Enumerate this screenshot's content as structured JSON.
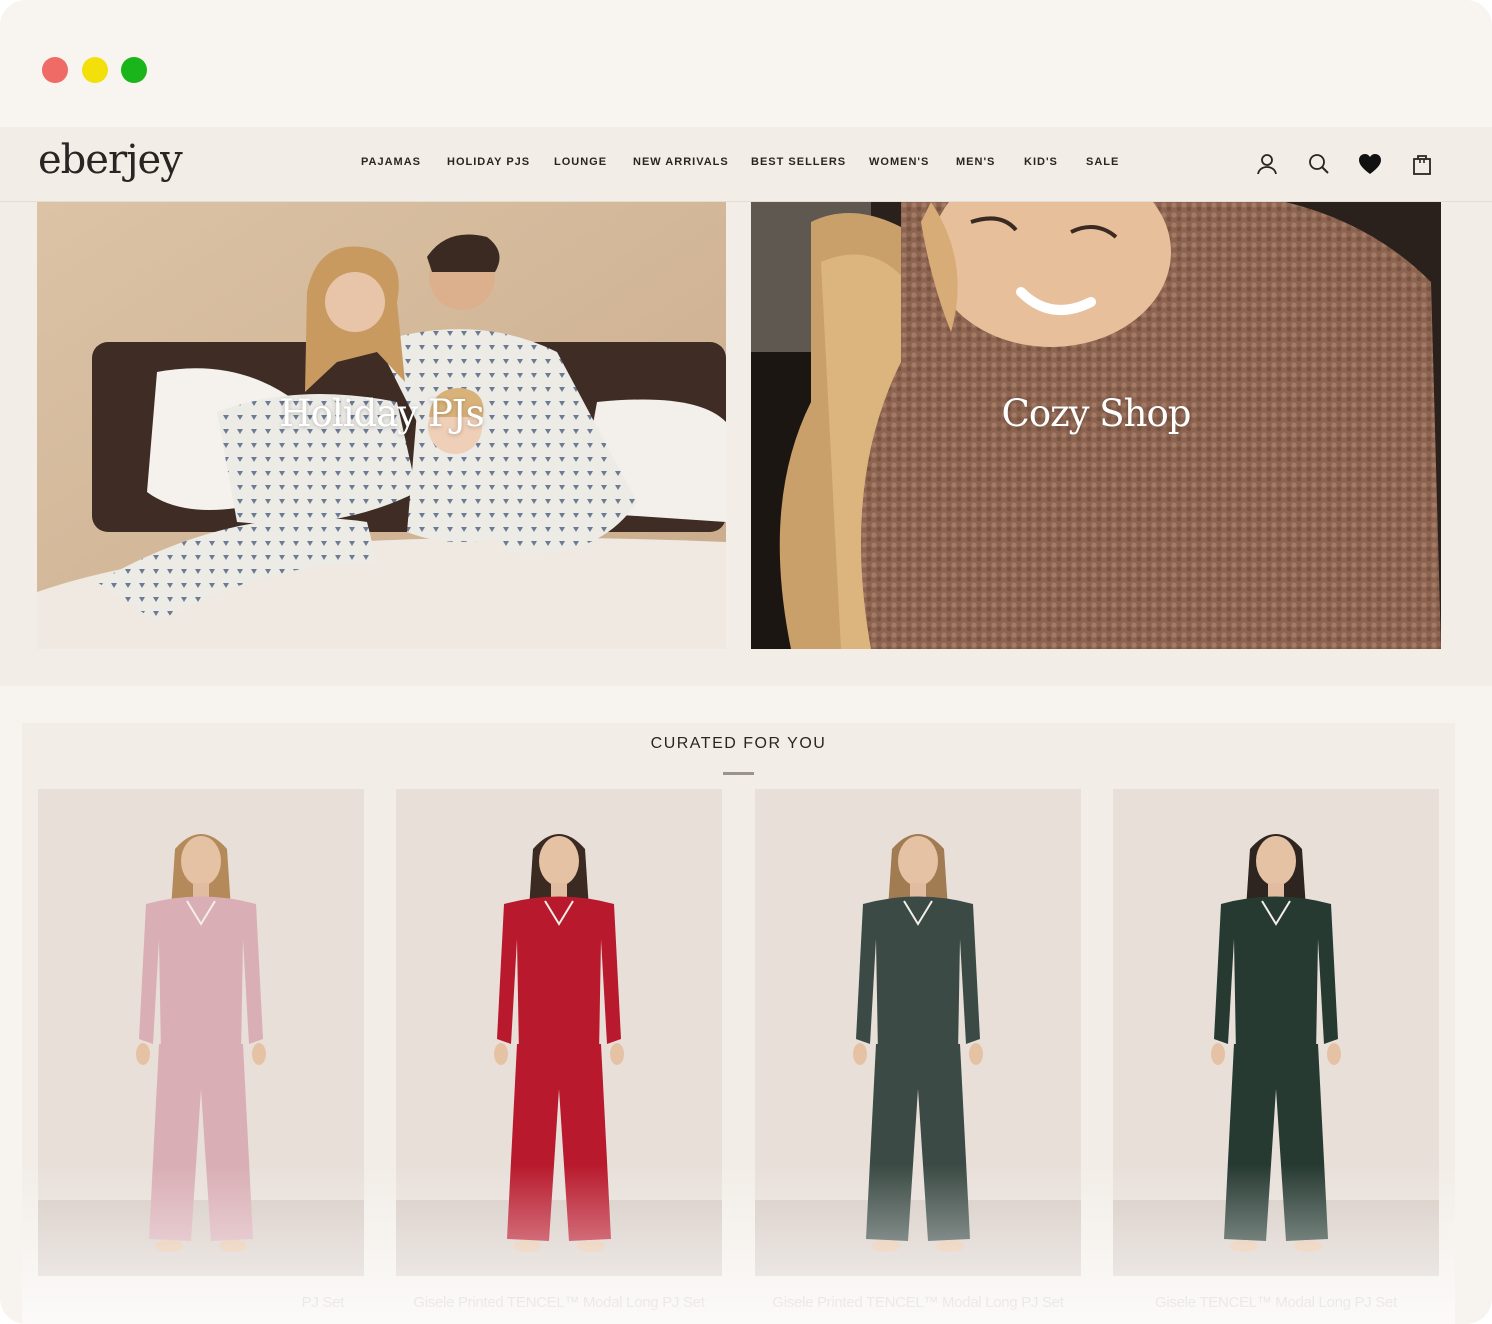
{
  "site": {
    "logo": "eberjey",
    "nav": [
      "PAJAMAS",
      "HOLIDAY PJS",
      "LOUNGE",
      "NEW ARRIVALS",
      "BEST SELLERS",
      "WOMEN'S",
      "MEN'S",
      "KID'S",
      "SALE"
    ],
    "icons": [
      "account-icon",
      "search-icon",
      "wishlist-heart-icon",
      "shopping-bag-icon"
    ]
  },
  "hero": {
    "tiles": [
      {
        "title": "Holiday PJs"
      },
      {
        "title": "Cozy Shop"
      }
    ]
  },
  "curated": {
    "title": "CURATED  FOR YOU",
    "products": [
      {
        "name": "PJ Set",
        "color": "#d9aeb5"
      },
      {
        "name": "Gisele Printed TENCEL™ Modal Long PJ Set",
        "color": "#b8192c"
      },
      {
        "name": "Gisele Printed TENCEL™ Modal Long PJ Set",
        "color": "#3b4a44"
      },
      {
        "name": "Gisele TENCEL™ Modal Long PJ Set",
        "color": "#263a32"
      }
    ]
  },
  "colors": {
    "background": "#f2ede7",
    "card": "#e8dfd9",
    "text": "#2a2522"
  }
}
